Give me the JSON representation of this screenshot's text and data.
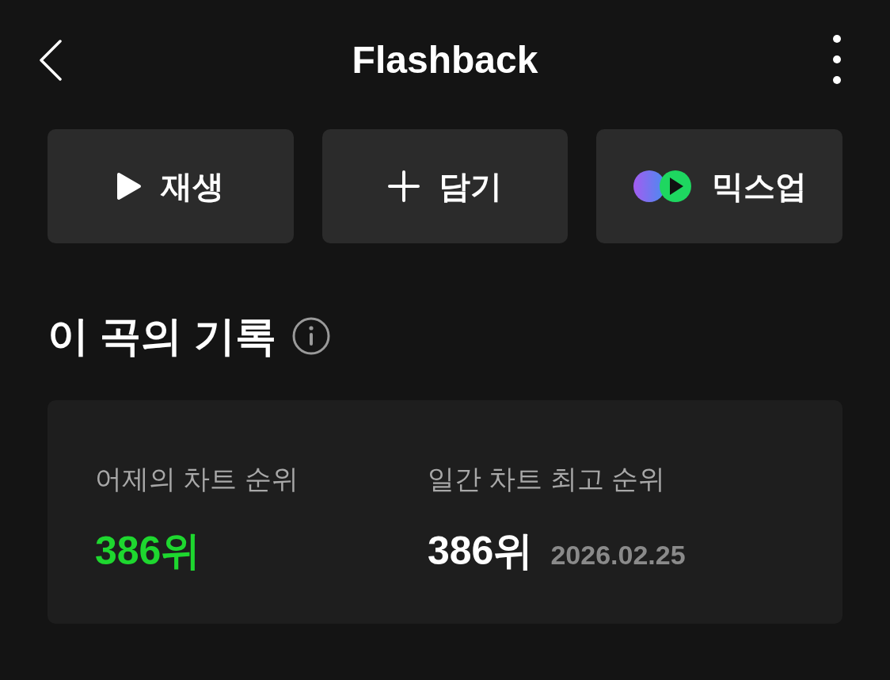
{
  "header": {
    "title": "Flashback"
  },
  "actions": [
    {
      "kind": "play",
      "label": "재생"
    },
    {
      "kind": "add",
      "label": "담기"
    },
    {
      "kind": "mixup",
      "label": "믹스업"
    }
  ],
  "section": {
    "title": "이 곡의 기록"
  },
  "stats": [
    {
      "label": "어제의 차트 순위",
      "value": "386위",
      "highlight": true
    },
    {
      "label": "일간 차트 최고 순위",
      "value": "386위",
      "highlight": false,
      "date": "2026.02.25"
    }
  ]
}
